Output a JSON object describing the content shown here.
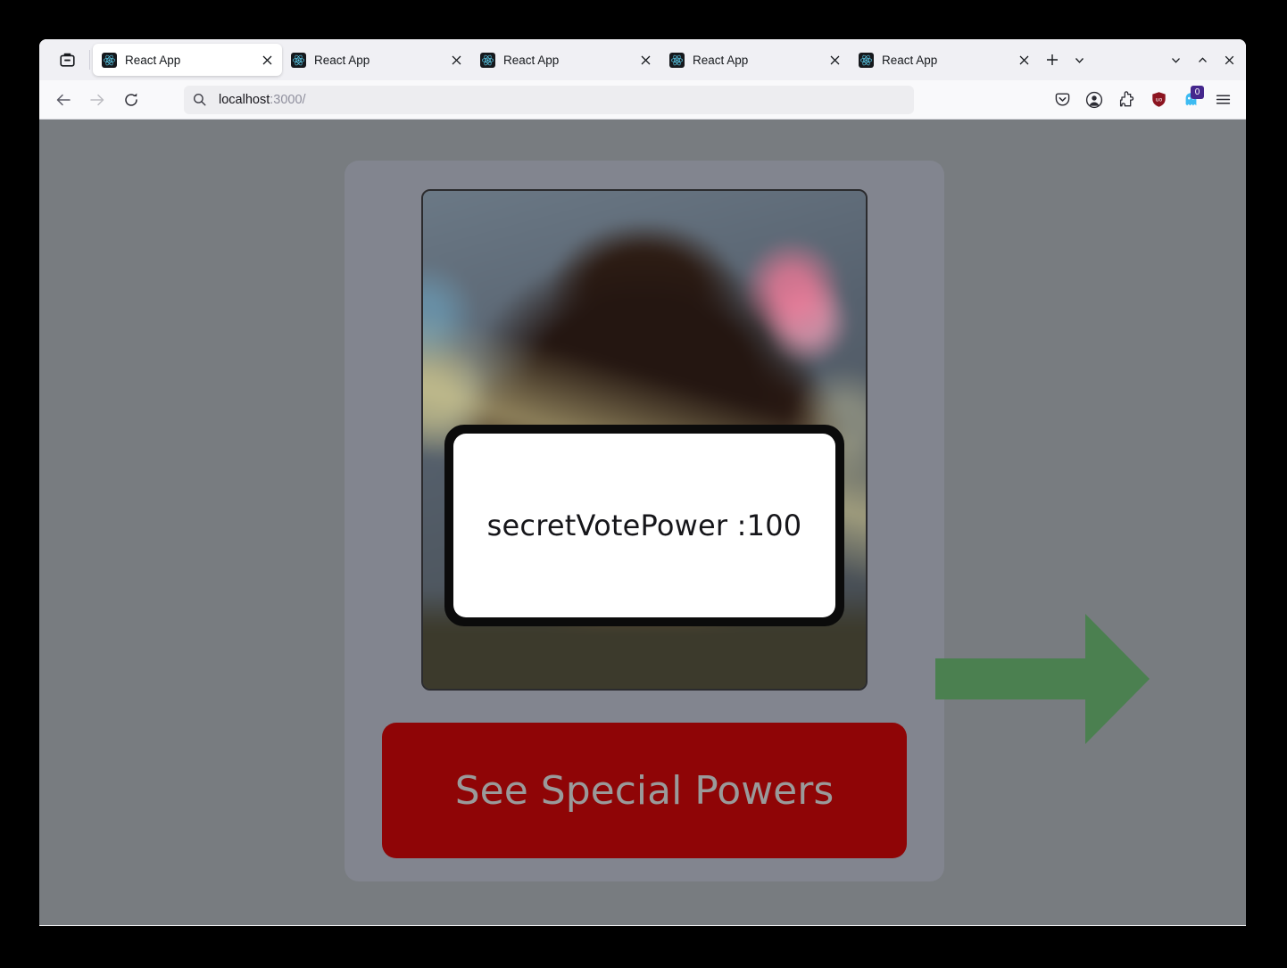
{
  "browser": {
    "firefox_view_label": "Firefox View",
    "tabs": [
      {
        "title": "React App",
        "favicon": "react-logo-icon",
        "active": true
      },
      {
        "title": "React App",
        "favicon": "react-logo-icon",
        "active": false
      },
      {
        "title": "React App",
        "favicon": "react-logo-icon",
        "active": false
      },
      {
        "title": "React App",
        "favicon": "react-logo-icon",
        "active": false
      },
      {
        "title": "React App",
        "favicon": "react-logo-icon",
        "active": false
      }
    ],
    "tab_close_label": "×",
    "new_tab_label": "+",
    "list_all_tabs_label": "v",
    "window_controls": {
      "minimize": "minimize-icon",
      "maximize": "maximize-icon",
      "close": "close-icon"
    },
    "nav": {
      "back": "back-arrow-icon",
      "forward": "forward-arrow-icon",
      "reload": "reload-icon"
    },
    "urlbar": {
      "search_icon": "search-icon",
      "host": "localhost",
      "rest": ":3000/",
      "full_url": "localhost:3000/"
    },
    "toolbar_right": [
      {
        "name": "pocket-icon",
        "label": "Save to Pocket"
      },
      {
        "name": "account-icon",
        "label": "Account"
      },
      {
        "name": "extensions-icon",
        "label": "Extensions"
      },
      {
        "name": "ublock-origin-icon",
        "label": "uBlock Origin"
      },
      {
        "name": "ghostery-icon",
        "label": "Ghostery",
        "badge": "0"
      },
      {
        "name": "app-menu-icon",
        "label": "Open application menu"
      }
    ]
  },
  "page": {
    "background_color": "#787c80",
    "card_color": "#82858f",
    "avatar": {
      "name": "profile-photo",
      "alt": "Blurred portrait of a person with curly dark hair"
    },
    "secret_overlay": {
      "text": "secretVotePower :100",
      "box_color": "#0b0b0b",
      "inner_color": "#ffffff"
    },
    "cta": {
      "label": "See Special Powers",
      "color": "#8f0506",
      "text_color": "#9a9a9a"
    },
    "annotation": {
      "arrow": "right-arrow-annotation",
      "color": "#4b8050",
      "direction": "right"
    }
  }
}
